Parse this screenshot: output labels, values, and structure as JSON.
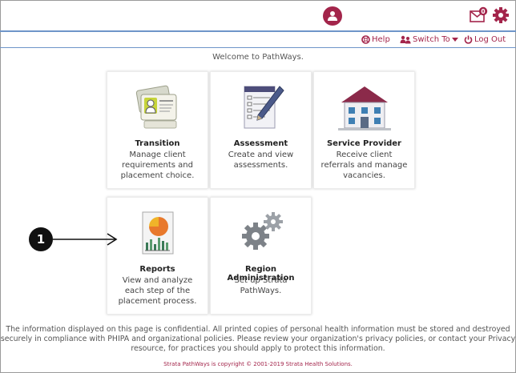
{
  "header": {
    "notification_count": "0",
    "links": {
      "help": "Help",
      "switch_to": "Switch To",
      "logout": "Log Out"
    }
  },
  "welcome": "Welcome to PathWays.",
  "tiles": [
    {
      "title": "Transition",
      "description": "Manage client requirements and placement choice.",
      "icon": "client-id-cards-icon"
    },
    {
      "title": "Assessment",
      "description": "Create and view assessments.",
      "icon": "clipboard-pen-icon"
    },
    {
      "title": "Service Provider",
      "description": "Receive client referrals and manage vacancies.",
      "icon": "building-icon"
    },
    {
      "title": "Reports",
      "description": "View and analyze each step of the placement process.",
      "icon": "report-chart-icon"
    },
    {
      "title": "Region Administration",
      "description": "Set up Strata PathWays.",
      "icon": "gears-icon"
    }
  ],
  "callout": {
    "number": "1"
  },
  "footer": {
    "confidentiality": "The information displayed on this page is confidential. All printed copies of personal health information must be stored and destroyed securely in compliance with PHIPA and organizational policies. Please review your organization's privacy policies, or contact your Privacy resource, for practices you should apply to protect this information.",
    "copyright": "Strata PathWays is copyright © 2001-2019 Strata Health Solutions."
  },
  "colors": {
    "accent": "#a3254b",
    "rule": "#6f95c9"
  }
}
